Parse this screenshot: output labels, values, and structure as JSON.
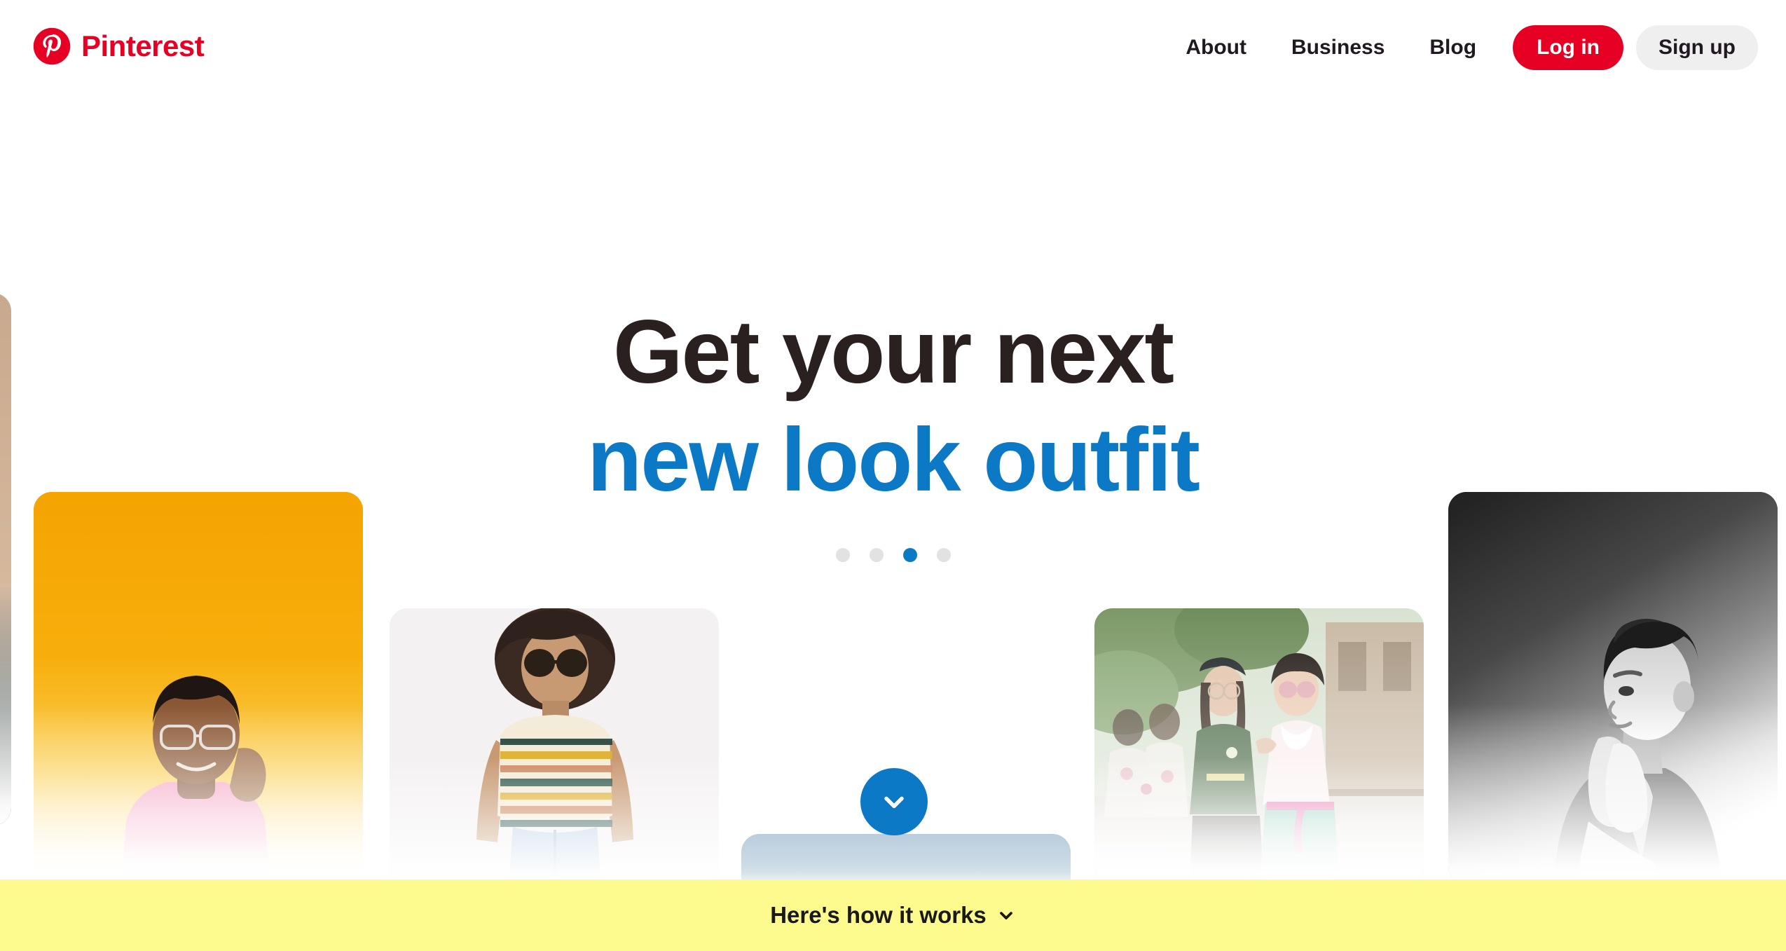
{
  "brand": {
    "name": "Pinterest",
    "logo_icon": "pinterest-logo-icon",
    "red": "#E60023"
  },
  "nav": {
    "links": [
      {
        "label": "About"
      },
      {
        "label": "Business"
      },
      {
        "label": "Blog"
      }
    ],
    "login_label": "Log in",
    "signup_label": "Sign up",
    "login_bg": "#E60023",
    "signup_bg": "#EFEFEF"
  },
  "hero": {
    "line1": "Get your next",
    "line2": "new look outfit",
    "line1_color": "#2B2020",
    "line2_color": "#0C79C6",
    "carousel": {
      "total": 4,
      "active_index": 2,
      "active_color": "#0C79C6",
      "inactive_color": "#E2E2E2"
    }
  },
  "scroll_button": {
    "icon": "chevron-down-icon",
    "color": "#0C79C6"
  },
  "cards": [
    {
      "id": "card-edge",
      "name": "carousel-card-partial-left",
      "description": "partially visible card at left edge"
    },
    {
      "id": "card-orange",
      "name": "carousel-card-orange-portrait",
      "description": "man in pink sweater on orange gradient"
    },
    {
      "id": "card-stripe",
      "name": "carousel-card-striped-tee",
      "description": "woman in striped tee and jeans"
    },
    {
      "id": "card-center",
      "name": "carousel-card-center-partial",
      "description": "partially visible light blue card"
    },
    {
      "id": "card-street",
      "name": "carousel-card-street-style",
      "description": "two women in street style outfits"
    },
    {
      "id": "card-mono",
      "name": "carousel-card-monochrome-portrait",
      "description": "black and white portrait of man"
    }
  ],
  "footer": {
    "label": "Here's how it works",
    "icon": "chevron-down-icon",
    "background": "#FDFA8E"
  }
}
